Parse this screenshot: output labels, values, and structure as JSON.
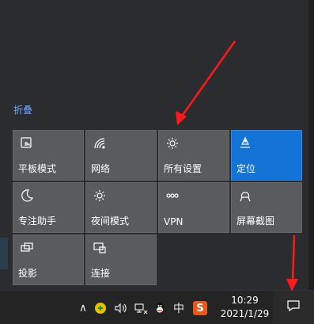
{
  "action_center": {
    "collapse_label": "折叠",
    "tiles": [
      {
        "label": "平板模式",
        "icon": "tablet-mode-icon",
        "active": false
      },
      {
        "label": "网络",
        "icon": "network-icon",
        "active": false
      },
      {
        "label": "所有设置",
        "icon": "gear-icon",
        "active": false
      },
      {
        "label": "定位",
        "icon": "location-icon",
        "active": true
      },
      {
        "label": "专注助手",
        "icon": "moon-icon",
        "active": false
      },
      {
        "label": "夜间模式",
        "icon": "sun-icon",
        "active": false
      },
      {
        "label": "VPN",
        "icon": "vpn-icon",
        "active": false
      },
      {
        "label": "屏幕截图",
        "icon": "screen-snip-icon",
        "active": false
      },
      {
        "label": "投影",
        "icon": "project-icon",
        "active": false
      },
      {
        "label": "连接",
        "icon": "connect-icon",
        "active": false
      }
    ],
    "accent": "#1473d6"
  },
  "taskbar": {
    "tray": {
      "chevron": "∧",
      "language": "中",
      "sogou_letter": "S"
    },
    "clock": {
      "time": "10:29",
      "date": "2021/1/29"
    }
  },
  "annotations": {
    "arrow_color": "#ff1a1a"
  }
}
